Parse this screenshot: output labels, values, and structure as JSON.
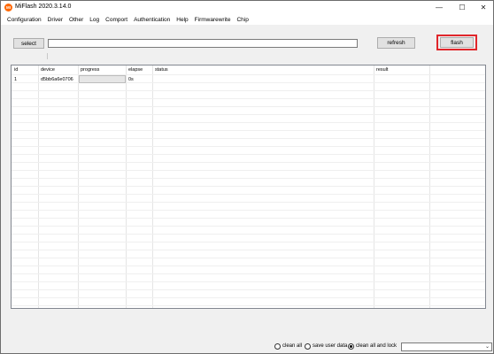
{
  "window": {
    "icon_text": "MI",
    "title": "MiFlash 2020.3.14.0",
    "min_glyph": "—",
    "max_glyph": "☐",
    "close_glyph": "✕"
  },
  "menu": [
    "Configuration",
    "Driver",
    "Other",
    "Log",
    "Comport",
    "Authentication",
    "Help",
    "Firmwarewrite",
    "Chip"
  ],
  "toolbar": {
    "select_label": "select",
    "path_value": "",
    "refresh_label": "refresh",
    "flash_label": "flash",
    "flash_highlight_color": "#e0262b"
  },
  "grid": {
    "columns": [
      "id",
      "device",
      "progress",
      "elapse",
      "status",
      "result"
    ],
    "rows": [
      {
        "id": "1",
        "device": "d5bb6a6e0706",
        "progress": 0,
        "elapse": "0s",
        "status": "",
        "result": ""
      }
    ]
  },
  "footer": {
    "options": [
      {
        "label": "clean all",
        "checked": false
      },
      {
        "label": "save user data",
        "checked": false
      },
      {
        "label": "clean all and lock",
        "checked": true
      }
    ],
    "dropdown_value": "",
    "dropdown_arrow": "⌄"
  }
}
